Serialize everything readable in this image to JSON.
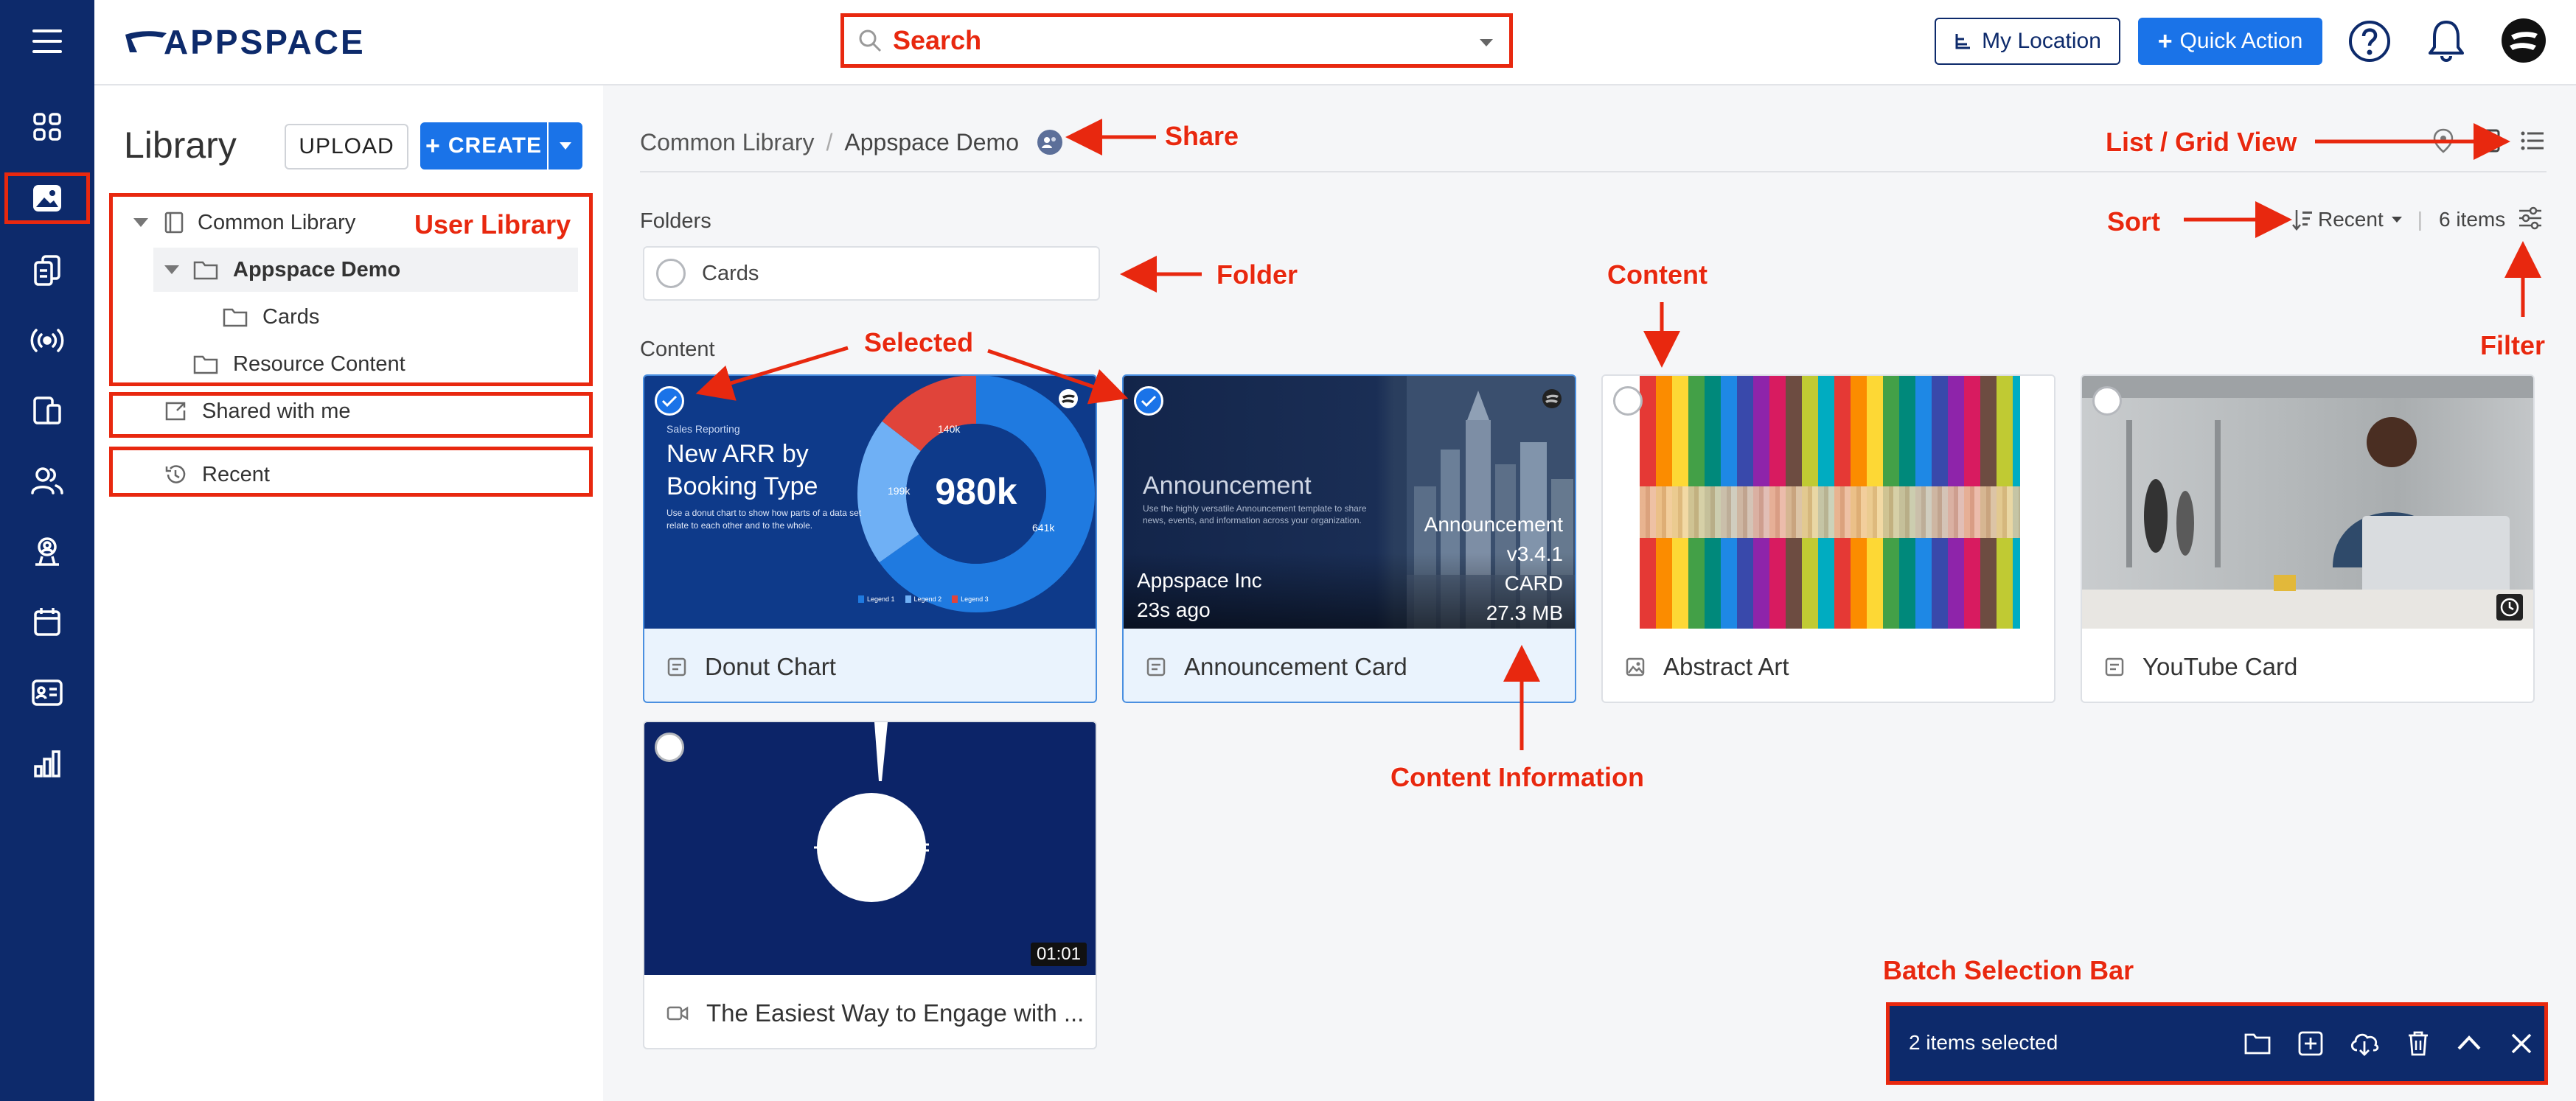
{
  "app": {
    "logo_text": "APPSPACE"
  },
  "search": {
    "label": "Search"
  },
  "header": {
    "my_location": "My Location",
    "quick_action": "Quick Action"
  },
  "left_nav": {
    "icons": [
      "dashboard-icon",
      "library-icon",
      "content-stack-icon",
      "broadcast-icon",
      "devices-icon",
      "users-icon",
      "user-badge-icon",
      "calendar-icon",
      "id-card-icon",
      "analytics-icon"
    ]
  },
  "sidebar": {
    "title": "Library",
    "upload": "UPLOAD",
    "create": "CREATE",
    "tree": {
      "common_library": "Common Library",
      "appspace_demo": "Appspace Demo",
      "cards": "Cards",
      "resource_content": "Resource Content"
    },
    "shared": "Shared with me",
    "recent": "Recent"
  },
  "breadcrumb": {
    "root": "Common Library",
    "current": "Appspace Demo"
  },
  "folders": {
    "heading": "Folders",
    "items": [
      "Cards"
    ]
  },
  "content": {
    "heading": "Content",
    "sort_label": "Recent",
    "count": "6 items",
    "items": [
      {
        "title": "Donut Chart",
        "selected": true,
        "type": "card",
        "thumb": {
          "kicker": "Sales Reporting",
          "headline_1": "New ARR by",
          "headline_2": "Booking Type",
          "body": "Use a donut chart to show how parts of a data set relate to each other and to the whole.",
          "center": "980k",
          "seg_a": "140k",
          "seg_b": "199k",
          "seg_c": "641k",
          "legend": [
            "Legend 1",
            "Legend 2",
            "Legend 3"
          ]
        }
      },
      {
        "title": "Announcement Card",
        "selected": true,
        "type": "card",
        "thumb": {
          "headline": "Announcement",
          "body": "Use the highly versatile Announcement template to share news, events, and information across your organization.",
          "owner": "Appspace Inc",
          "time": "23s ago",
          "info_1": "Announcement",
          "info_2": "v3.4.1",
          "info_3": "CARD",
          "info_4": "27.3 MB"
        }
      },
      {
        "title": "Abstract Art",
        "selected": false,
        "type": "image"
      },
      {
        "title": "YouTube Card",
        "selected": false,
        "type": "card"
      },
      {
        "title": "The Easiest Way to Engage with ...",
        "selected": false,
        "type": "video",
        "duration": "01:01"
      }
    ]
  },
  "batch_bar": {
    "label": "2 items selected"
  },
  "annotations": {
    "search": "Search",
    "share": "Share",
    "list_grid": "List / Grid View",
    "sort": "Sort",
    "filter": "Filter",
    "user_library": "User Library",
    "selected": "Selected",
    "folder": "Folder",
    "content": "Content",
    "content_information": "Content Information",
    "batch_selection_bar": "Batch Selection Bar"
  },
  "colors": {
    "nav": "#0d2a6b",
    "accent": "#1a73e8",
    "annotation": "#e8280f",
    "batch_bar": "#0d2a6b"
  }
}
